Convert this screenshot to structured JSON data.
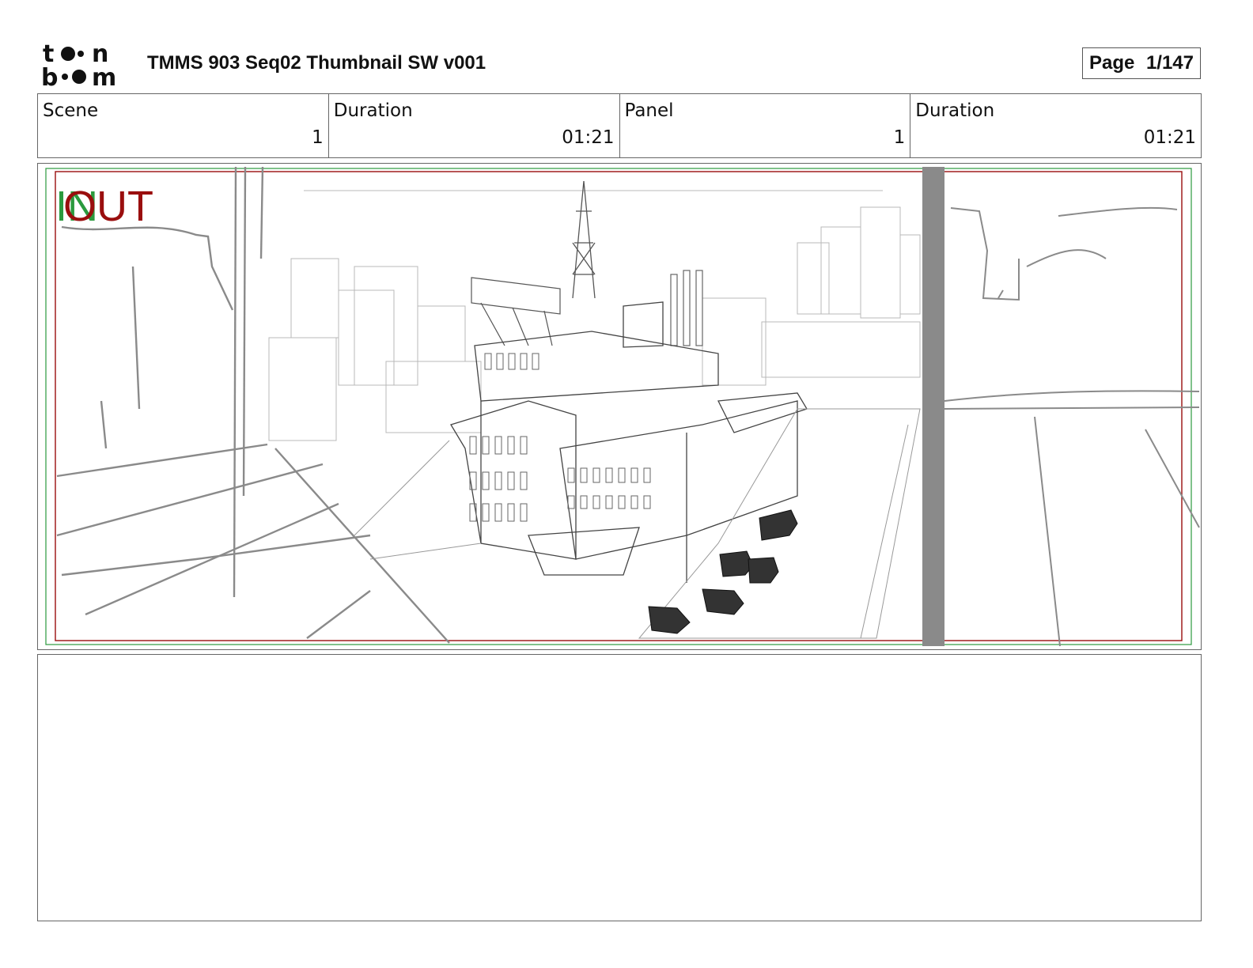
{
  "header": {
    "logo_text": "toon boom",
    "title": "TMMS 903 Seq02 Thumbnail SW v001",
    "page_label": "Page",
    "page_value": "1/147"
  },
  "info": [
    {
      "label": "Scene",
      "value": "1"
    },
    {
      "label": "Duration",
      "value": "01:21"
    },
    {
      "label": "Panel",
      "value": "1"
    },
    {
      "label": "Duration",
      "value": "01:21"
    }
  ],
  "panel": {
    "in_label": "IN",
    "out_label": "OUT",
    "safe_area_colors": {
      "in": "#2b9a3e",
      "out": "#9a0e0e"
    }
  },
  "notes": {
    "text": ""
  }
}
